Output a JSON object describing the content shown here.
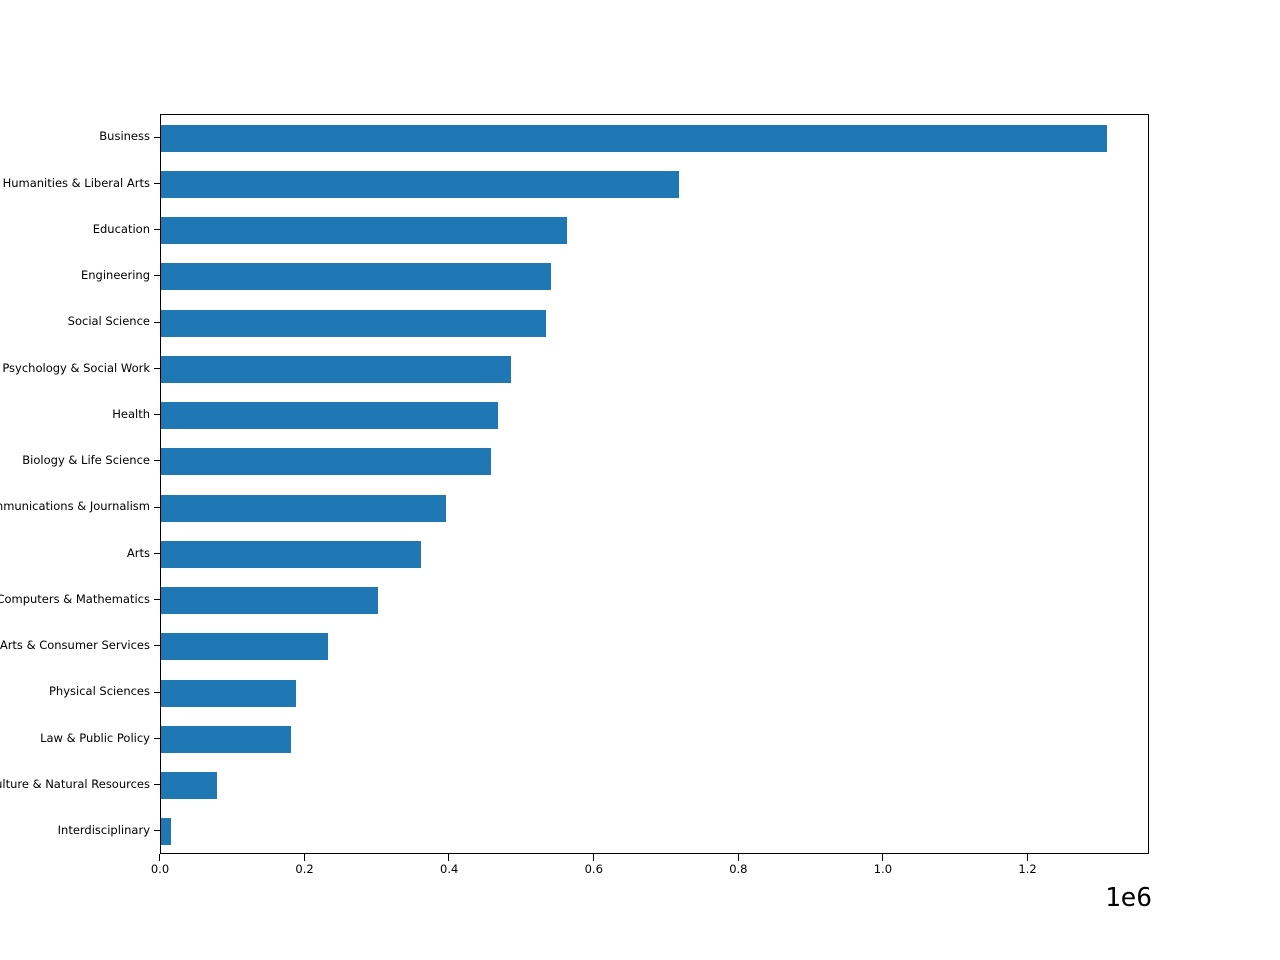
{
  "chart_data": {
    "type": "bar",
    "orientation": "horizontal",
    "title": "",
    "xlabel": "",
    "ylabel": "",
    "categories": [
      "Business",
      "Humanities & Liberal Arts",
      "Education",
      "Engineering",
      "Social Science",
      "Psychology & Social Work",
      "Health",
      "Biology & Life Science",
      "Communications & Journalism",
      "Arts",
      "Computers & Mathematics",
      "Industrial Arts & Consumer Services",
      "Physical Sciences",
      "Law & Public Policy",
      "Agriculture & Natural Resources",
      "Interdisciplinary"
    ],
    "values": [
      1308000,
      717000,
      562000,
      540000,
      532000,
      484000,
      466000,
      457000,
      394000,
      360000,
      300000,
      231000,
      187000,
      180000,
      78000,
      14000
    ],
    "bar_color": "#1f77b4",
    "xlim": [
      0,
      1368000
    ],
    "xticks": [
      0,
      200000,
      400000,
      600000,
      800000,
      1000000,
      1200000
    ],
    "xtick_labels": [
      "0.0",
      "0.2",
      "0.4",
      "0.6",
      "0.8",
      "1.0",
      "1.2"
    ],
    "x_offset_label": "1e6",
    "grid": false,
    "legend": null
  },
  "axis": {
    "ytick_labels_clipped": [
      "Business",
      "Humanities & Liberal Arts",
      "Education",
      "Engineering",
      "Social Science",
      "Psychology & Social Work",
      "Health",
      "Biology & Life Science",
      "Communications & Journalism",
      "Arts",
      "Computers & Mathematics",
      "Industrial Arts & Consumer Services",
      "Physical Sciences",
      "Law & Public Policy",
      "Agriculture & Natural Resources",
      "Interdisciplinary"
    ]
  }
}
